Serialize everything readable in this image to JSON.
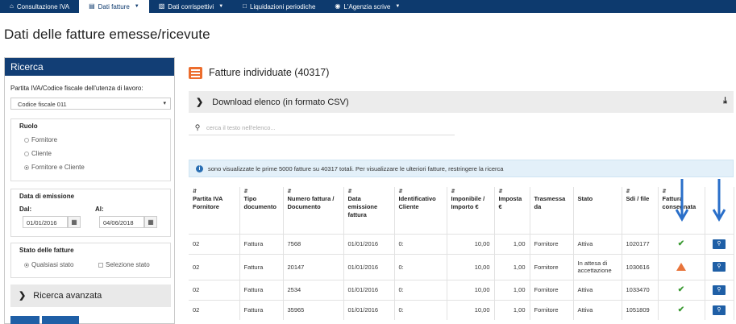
{
  "nav": {
    "items": [
      {
        "icon": "home-icon",
        "label": "Consultazione IVA",
        "active": false,
        "caret": false
      },
      {
        "icon": "document-icon",
        "label": "Dati fatture",
        "active": true,
        "caret": true
      },
      {
        "icon": "register-icon",
        "label": "Dati corrispettivi",
        "active": false,
        "caret": true
      },
      {
        "icon": "file-icon",
        "label": "Liquidazioni periodiche",
        "active": false,
        "caret": false
      },
      {
        "icon": "globe-icon",
        "label": "L'Agenzia scrive",
        "active": false,
        "caret": true
      }
    ]
  },
  "page_title": "Dati delle fatture emesse/ricevute",
  "search_panel": {
    "title": "Ricerca",
    "partita_label": "Partita IVA/Codice fiscale dell'utenza di lavoro:",
    "partita_value": "Codice fiscale 011",
    "ruolo": {
      "title": "Ruolo",
      "options": [
        "Fornitore",
        "Cliente",
        "Fornitore e Cliente"
      ],
      "selected": "Fornitore e Cliente"
    },
    "data_emissione": {
      "title": "Data di emissione",
      "dal_label": "Dal:",
      "dal_value": "01/01/2016",
      "al_label": "Al:",
      "al_value": "04/06/2018"
    },
    "stato": {
      "title": "Stato delle fatture",
      "option_all": "Qualsiasi stato",
      "option_select": "Selezione stato"
    },
    "advanced_label": "Ricerca avanzata"
  },
  "results": {
    "title": "Fatture individuate (40317)",
    "download_label": "Download elenco (in formato CSV)",
    "search_placeholder": "cerca il testo nell'elenco...",
    "info_text": "sono visualizzate le prime 5000 fatture su 40317 totali. Per visualizzare le ulteriori fatture, restringere la ricerca",
    "columns": [
      "Partita IVA Fornitore",
      "Tipo documento",
      "Numero fattura / Documento",
      "Data emissione fattura",
      "Identificativo Cliente",
      "Imponibile / Importo €",
      "Imposta €",
      "Trasmessa da",
      "Stato",
      "Sdi / file",
      "Fattura consegnata",
      ""
    ],
    "rows": [
      {
        "piva": "02",
        "tipo": "Fattura",
        "numero": "7568",
        "data": "01/01/2016",
        "cliente": "0:",
        "imponibile": "10,00",
        "imposta": "1,00",
        "trasmessa": "Fornitore",
        "stato": "Attiva",
        "sdi": "1020177",
        "consegna": "check"
      },
      {
        "piva": "02",
        "tipo": "Fattura",
        "numero": "20147",
        "data": "01/01/2016",
        "cliente": "0:",
        "imponibile": "10,00",
        "imposta": "1,00",
        "trasmessa": "Fornitore",
        "stato": "In attesa di accettazione",
        "sdi": "1030616",
        "consegna": "warning"
      },
      {
        "piva": "02",
        "tipo": "Fattura",
        "numero": "2534",
        "data": "01/01/2016",
        "cliente": "0:",
        "imponibile": "10,00",
        "imposta": "1,00",
        "trasmessa": "Fornitore",
        "stato": "Attiva",
        "sdi": "1033470",
        "consegna": "check"
      },
      {
        "piva": "02",
        "tipo": "Fattura",
        "numero": "35965",
        "data": "01/01/2016",
        "cliente": "0:",
        "imponibile": "10,00",
        "imposta": "1,00",
        "trasmessa": "Fornitore",
        "stato": "Attiva",
        "sdi": "1051809",
        "consegna": "check"
      }
    ]
  },
  "colors": {
    "nav": "#0d3a6e",
    "accent": "#1f5fa6",
    "orange": "#ec6d2d",
    "check": "#3a9a32",
    "warning": "#e8743b",
    "annotation_arrow": "#2a6fc9"
  }
}
